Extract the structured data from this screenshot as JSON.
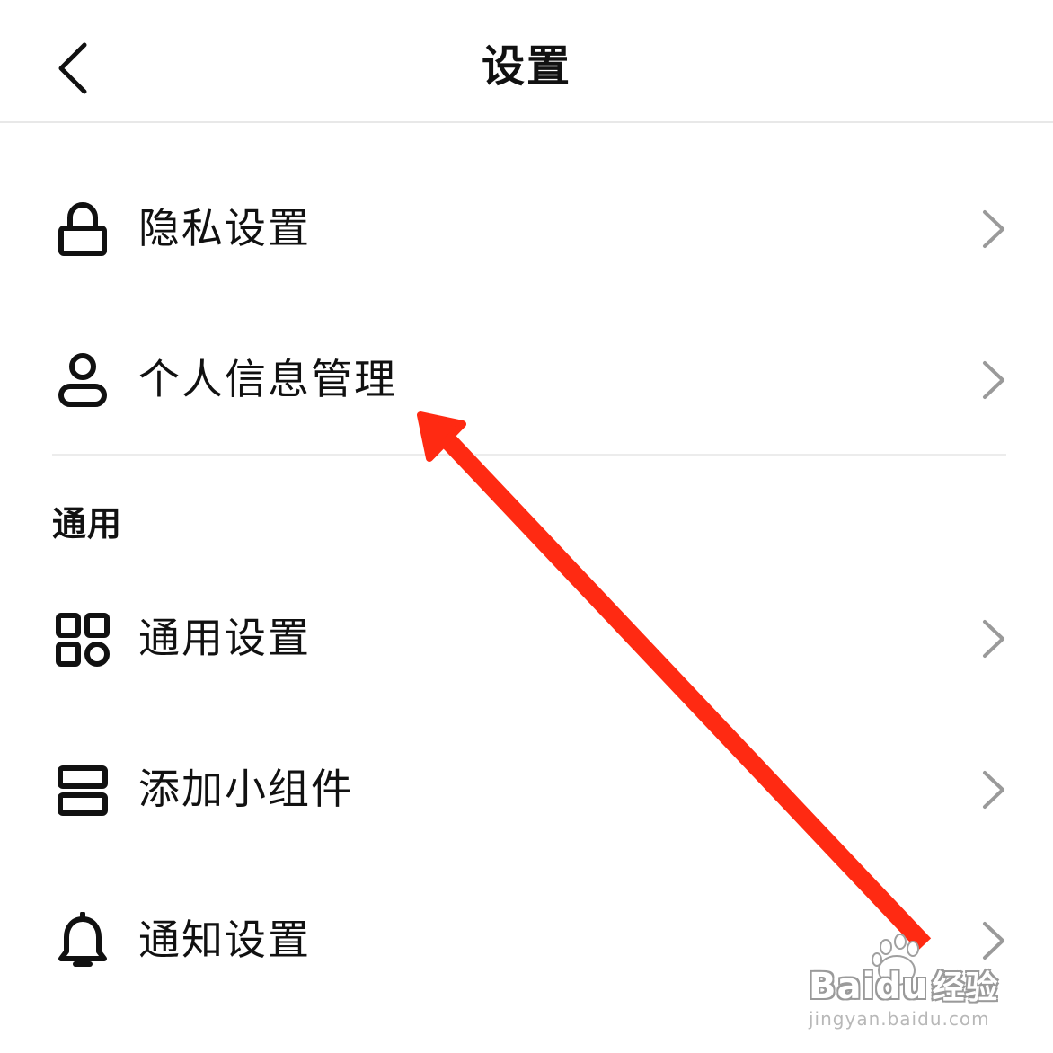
{
  "header": {
    "title": "设置"
  },
  "privacy_section": {
    "items": [
      {
        "label": "隐私设置",
        "icon": "lock-icon"
      },
      {
        "label": "个人信息管理",
        "icon": "person-icon"
      }
    ]
  },
  "general_section": {
    "title": "通用",
    "items": [
      {
        "label": "通用设置",
        "icon": "grid-icon"
      },
      {
        "label": "添加小组件",
        "icon": "widget-icon"
      },
      {
        "label": "通知设置",
        "icon": "bell-icon"
      }
    ]
  },
  "annotation": {
    "color": "#ff2a12"
  },
  "watermark": {
    "brand_left": "Bai",
    "brand_right": "du",
    "brand_cn": "经验",
    "url": "jingyan.baidu.com"
  }
}
